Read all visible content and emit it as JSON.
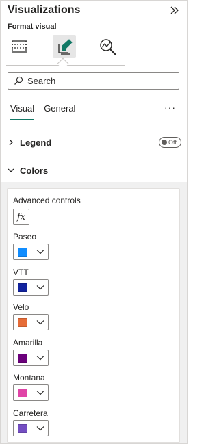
{
  "pane": {
    "title": "Visualizations",
    "subtitle": "Format visual"
  },
  "format_tabs": [
    {
      "name": "build-visual",
      "icon": "table-grid-icon"
    },
    {
      "name": "format-visual",
      "icon": "paint-brush-icon",
      "active": true
    },
    {
      "name": "analytics",
      "icon": "analytics-magnifier-icon"
    }
  ],
  "search": {
    "placeholder": "Search",
    "value": ""
  },
  "subtabs": {
    "visual": "Visual",
    "general": "General",
    "more": "···"
  },
  "sections": {
    "legend": {
      "label": "Legend",
      "toggle": "Off"
    },
    "colors": {
      "label": "Colors"
    }
  },
  "colors_card": {
    "advanced_label": "Advanced controls",
    "fx_label": "fx",
    "items": [
      {
        "name": "Paseo",
        "color": "#118dff"
      },
      {
        "name": "VTT",
        "color": "#12239e"
      },
      {
        "name": "Velo",
        "color": "#e66c37"
      },
      {
        "name": "Amarilla",
        "color": "#6b007b"
      },
      {
        "name": "Montana",
        "color": "#e044a7"
      },
      {
        "name": "Carretera",
        "color": "#744ec2"
      }
    ]
  },
  "accent": "#117865"
}
